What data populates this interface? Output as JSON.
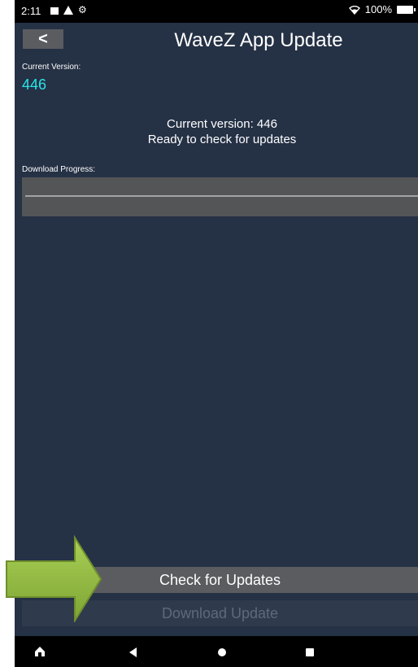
{
  "status_bar": {
    "time": "2:11",
    "battery": "100%",
    "icons": [
      "notification-square-icon",
      "alert-triangle-icon",
      "gear-icon",
      "wifi-icon",
      "battery-icon"
    ]
  },
  "header": {
    "back_label": "<",
    "title": "WaveZ App Update"
  },
  "version": {
    "label": "Current Version:",
    "value": "446"
  },
  "status": {
    "line1": "Current version: 446",
    "line2": "Ready to check for updates"
  },
  "progress": {
    "label": "Download Progress:",
    "value": 0
  },
  "buttons": {
    "check_label": "Check for Updates",
    "download_label": "Download Update"
  },
  "nav": {
    "icons": [
      "home-app-icon",
      "nav-back-icon",
      "nav-home-icon",
      "nav-recents-icon"
    ]
  },
  "colors": {
    "background": "#253145",
    "accent": "#2ae3e8",
    "button": "#5b5c60",
    "arrow": "#8cb53f"
  }
}
